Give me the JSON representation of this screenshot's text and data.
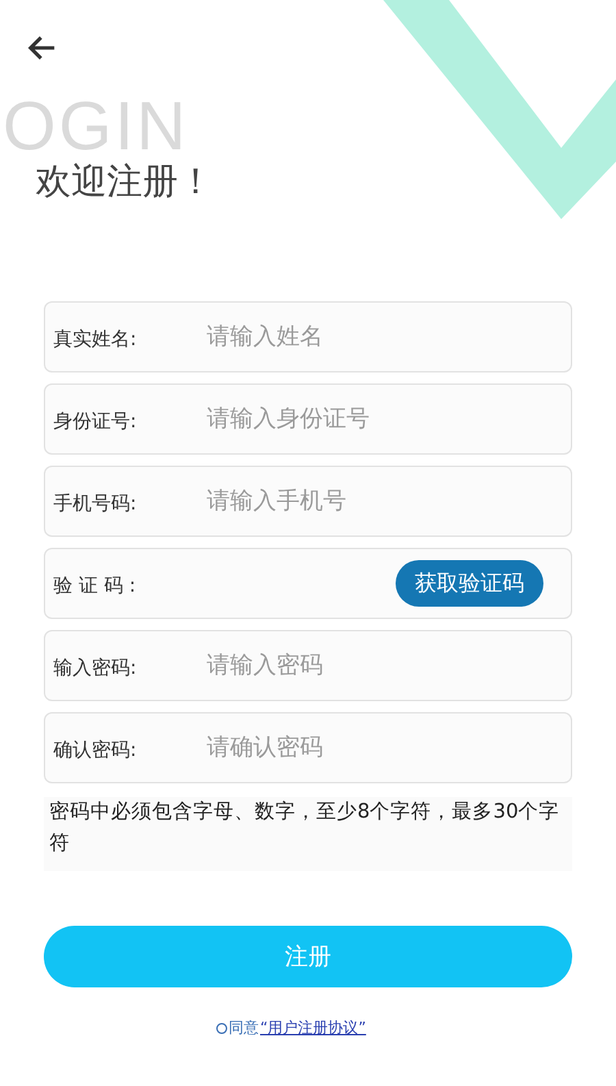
{
  "header": {
    "background_text": "OGIN",
    "title": "欢迎注册！"
  },
  "fields": [
    {
      "kind": "input",
      "label": "真实姓名:",
      "placeholder": "请输入姓名"
    },
    {
      "kind": "input",
      "label": "身份证号:",
      "placeholder": "请输入身份证号"
    },
    {
      "kind": "input",
      "label": "手机号码:",
      "placeholder": "请输入手机号"
    },
    {
      "kind": "code",
      "label": "验 证 码 :",
      "button": "获取验证码"
    },
    {
      "kind": "input",
      "label": "输入密码:",
      "placeholder": "请输入密码"
    },
    {
      "kind": "input",
      "label": "确认密码:",
      "placeholder": "请确认密码"
    }
  ],
  "password_hint": "密码中必须包含字母、数字，至少8个字符，最多30个字符",
  "submit_button": "注册",
  "agreement": {
    "checked": false,
    "text": "同意",
    "link": "“用户注册协议”"
  }
}
